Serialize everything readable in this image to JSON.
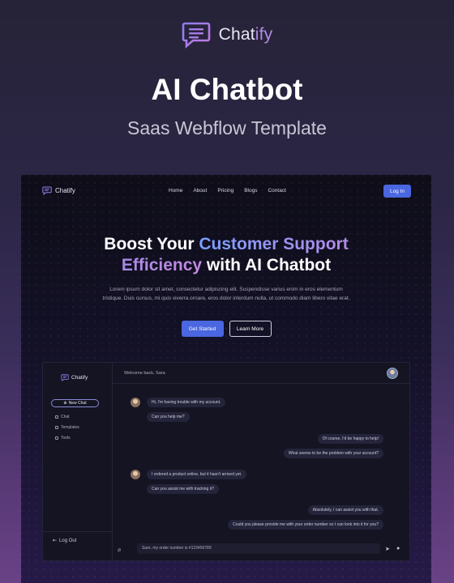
{
  "brand": {
    "name_main": "Chat",
    "name_accent": "ify"
  },
  "title": "AI Chatbot",
  "subtitle": "Saas Webflow Template",
  "preview": {
    "nav": {
      "logo_text": "Chatify",
      "links": [
        "Home",
        "About",
        "Pricing",
        "Blogs",
        "Contact"
      ],
      "login_label": "Log In"
    },
    "hero": {
      "line1_plain": "Boost Your ",
      "line1_accent": "Customer Support",
      "line2_accent": "Efficiency",
      "line2_plain": " with AI Chatbot",
      "description": "Lorem ipsum dolor sit amet, consectetur adipiscing elit. Suspendisse varius enim in eros elementum tristique. Duis cursus, mi quis viverra ornare, eros dolor interdum nulla, ut commodo diam libero vitae erat.",
      "primary_button": "Get Started",
      "secondary_button": "Learn More"
    },
    "app": {
      "logo_text": "Chatify",
      "new_chat": "New Chat",
      "sidebar_items": [
        "Chat",
        "Templates",
        "Tools"
      ],
      "logout": "Log Out",
      "welcome": "Welcome back, Sara",
      "messages": [
        {
          "from": "user",
          "text": "Hi, I'm having trouble with my account."
        },
        {
          "from": "user",
          "text": "Can you help me?"
        },
        {
          "from": "bot",
          "text": "Of course, I'd be happy to help!"
        },
        {
          "from": "bot",
          "text": "What seems to be the problem with your account?"
        },
        {
          "from": "user",
          "text": "I ordered a product online, but it hasn't arrived yet."
        },
        {
          "from": "user",
          "text": "Can you assist me with tracking it?"
        },
        {
          "from": "bot",
          "text": "Absolutely, I can assist you with that."
        },
        {
          "from": "bot",
          "text": "Could you please provide me with your order number so I can look into it for you?"
        }
      ],
      "input_value": "Sure, my order number is #123456789"
    }
  },
  "colors": {
    "accent_blue": "#4a66e0",
    "accent_purple": "#b48be8"
  }
}
